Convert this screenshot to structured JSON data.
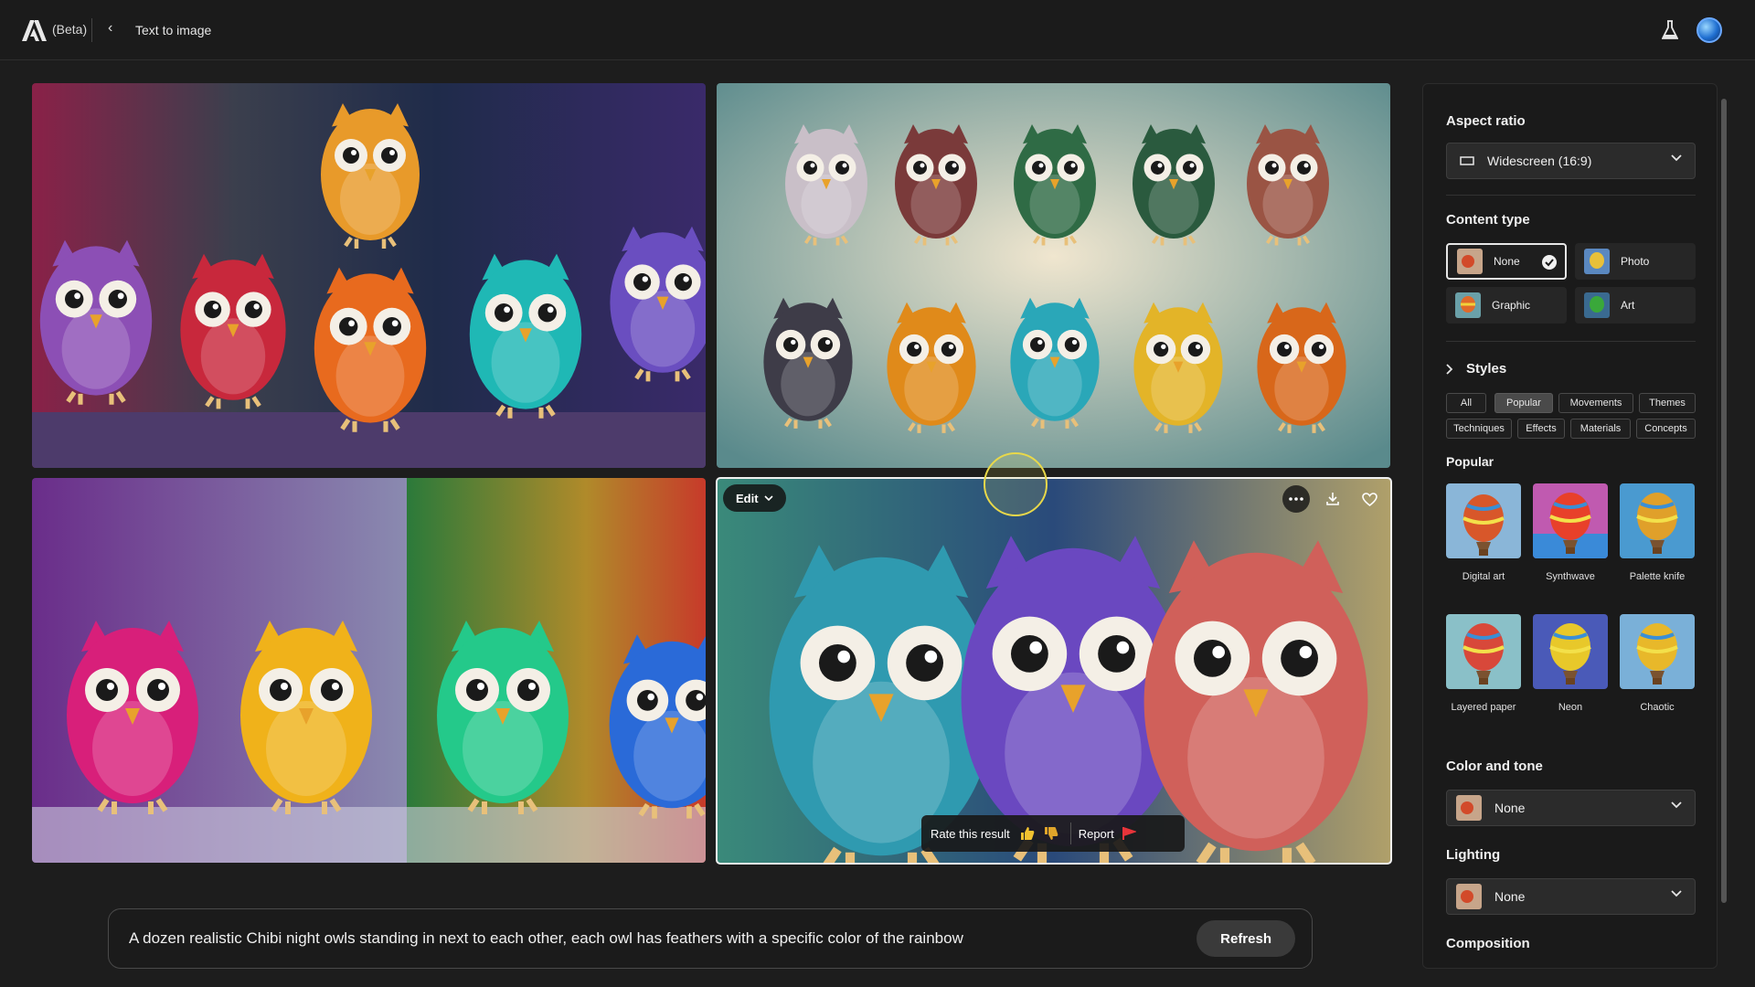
{
  "topbar": {
    "beta_label": "(Beta)",
    "back_icon": "chevron-left-icon",
    "breadcrumb": "Text to image",
    "labs_icon": "flask-icon"
  },
  "images": {
    "edit_label": "Edit",
    "more_icon": "more-icon",
    "download_icon": "download-icon",
    "favorite_icon": "heart-icon"
  },
  "feedback": {
    "rate_label": "Rate this result",
    "report_label": "Report"
  },
  "prompt": {
    "text": "A dozen realistic Chibi night owls standing in next to each other, each owl has feathers with a specific color of the rainbow",
    "refresh_label": "Refresh"
  },
  "panel": {
    "aspect_ratio": {
      "title": "Aspect ratio",
      "value": "Widescreen (16:9)"
    },
    "content_type": {
      "title": "Content type",
      "options": [
        {
          "label": "None",
          "selected": true
        },
        {
          "label": "Photo",
          "selected": false
        },
        {
          "label": "Graphic",
          "selected": false
        },
        {
          "label": "Art",
          "selected": false
        }
      ]
    },
    "styles": {
      "title": "Styles",
      "filters": [
        "All",
        "Popular",
        "Movements",
        "Themes",
        "Techniques",
        "Effects",
        "Materials",
        "Concepts"
      ],
      "active_filter": "Popular",
      "section_title": "Popular",
      "items": [
        "Digital art",
        "Synthwave",
        "Palette knife",
        "Layered paper",
        "Neon",
        "Chaotic"
      ]
    },
    "color_tone": {
      "title": "Color and tone",
      "value": "None"
    },
    "lighting": {
      "title": "Lighting",
      "value": "None"
    },
    "composition": {
      "title": "Composition"
    }
  },
  "colors": {
    "background": "#1d1d1d",
    "panel": "#1a1a1a",
    "report_flag": "#e8343a",
    "thumb_up": "#f2c230",
    "thumb_down": "#e0a52a"
  }
}
